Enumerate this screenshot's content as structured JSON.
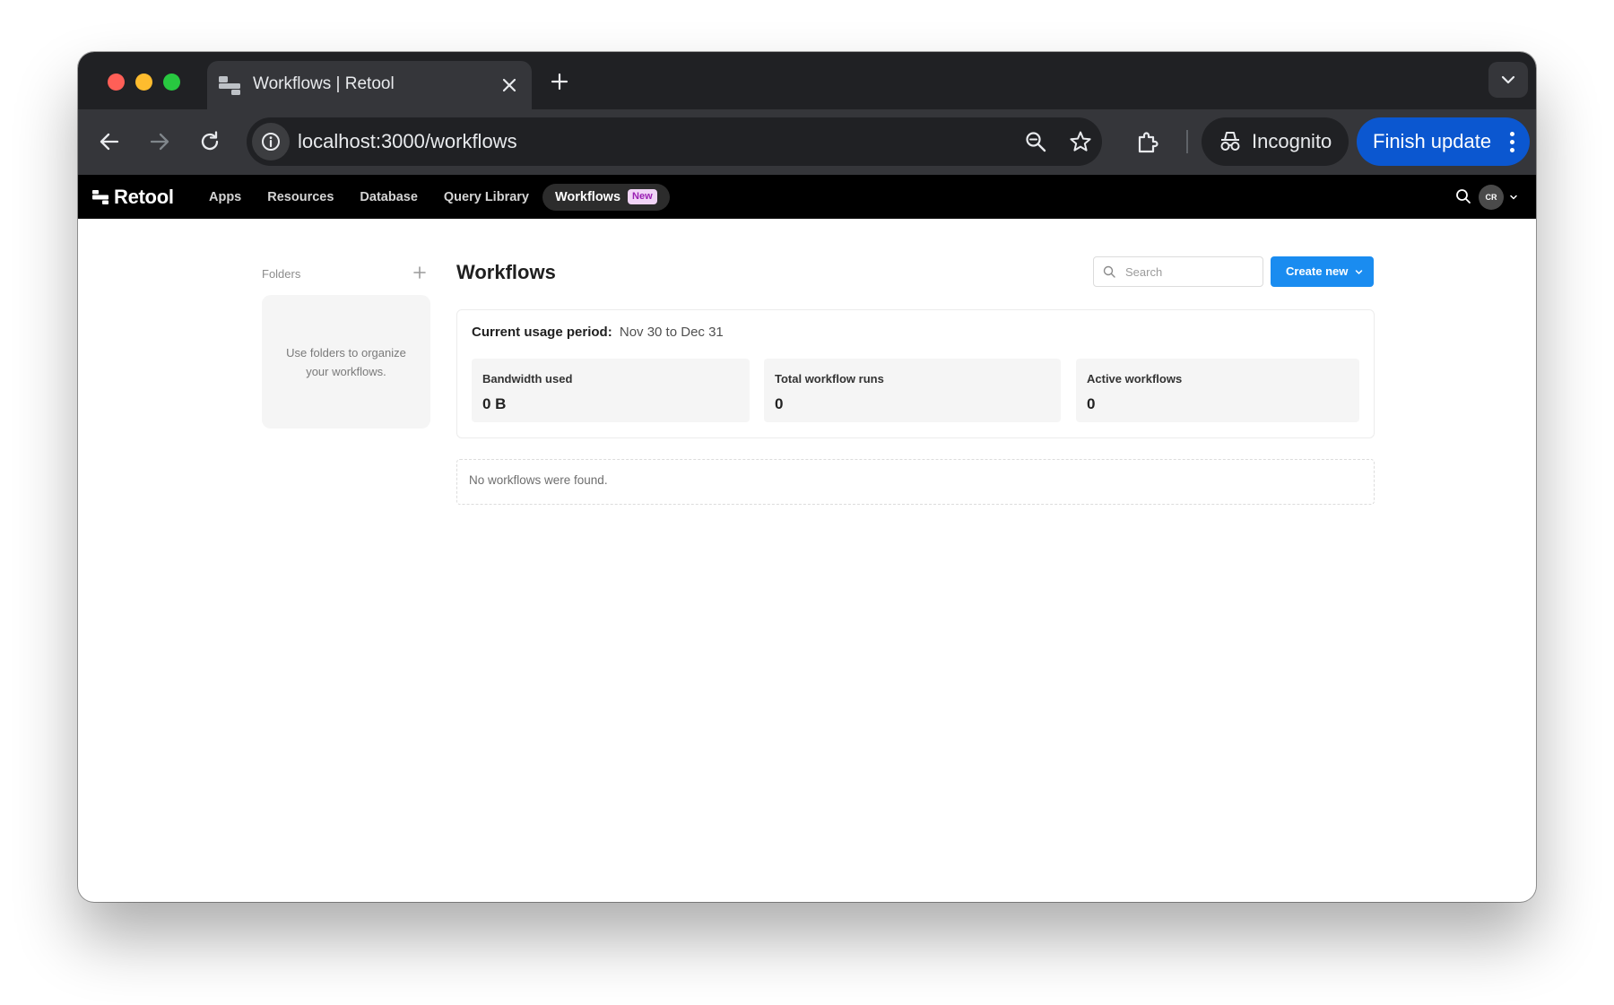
{
  "browser": {
    "tab_title": "Workflows | Retool",
    "url": "localhost:3000/workflows",
    "incognito_label": "Incognito",
    "finish_update_label": "Finish update"
  },
  "app": {
    "logo_text": "Retool",
    "nav": {
      "apps": "Apps",
      "resources": "Resources",
      "database": "Database",
      "query_library": "Query Library",
      "workflows": "Workflows",
      "workflows_badge": "New"
    },
    "avatar_initials": "CR"
  },
  "folders": {
    "label": "Folders",
    "empty_message": "Use folders to organize your workflows."
  },
  "main": {
    "title": "Workflows",
    "search_placeholder": "Search",
    "create_button": "Create new",
    "usage": {
      "label": "Current usage period:",
      "range": "Nov 30 to Dec 31",
      "stats": [
        {
          "label": "Bandwidth used",
          "value": "0 B"
        },
        {
          "label": "Total workflow runs",
          "value": "0"
        },
        {
          "label": "Active workflows",
          "value": "0"
        }
      ]
    },
    "empty_message": "No workflows were found."
  },
  "colors": {
    "accent_blue": "#1a8cf0",
    "chrome_update_blue": "#0b57d0",
    "nav_background": "#000000",
    "badge_background": "#f1d4f7",
    "badge_text": "#9a1fb3"
  }
}
